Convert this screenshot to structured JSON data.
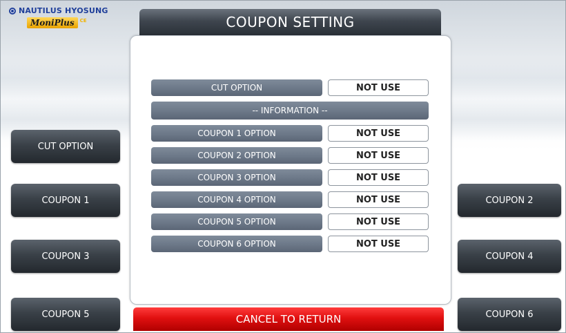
{
  "brand": {
    "company": "NAUTILUS HYOSUNG",
    "product": "MoniPlus",
    "product_suffix": "CE"
  },
  "title": "COUPON SETTING",
  "settings": {
    "cut_option": {
      "label": "CUT OPTION",
      "value": "NOT USE"
    },
    "information_header": "-- INFORMATION --",
    "coupons": [
      {
        "label": "COUPON 1 OPTION",
        "value": "NOT USE"
      },
      {
        "label": "COUPON 2 OPTION",
        "value": "NOT USE"
      },
      {
        "label": "COUPON 3 OPTION",
        "value": "NOT USE"
      },
      {
        "label": "COUPON 4 OPTION",
        "value": "NOT USE"
      },
      {
        "label": "COUPON 5 OPTION",
        "value": "NOT USE"
      },
      {
        "label": "COUPON 6 OPTION",
        "value": "NOT USE"
      }
    ]
  },
  "left_buttons": [
    "CUT OPTION",
    "COUPON 1",
    "COUPON 3",
    "COUPON 5"
  ],
  "right_buttons": [
    "COUPON 2",
    "COUPON 4",
    "COUPON 6"
  ],
  "cancel_label": "CANCEL TO RETURN",
  "colors": {
    "title_bar": "#3f464f",
    "row_label": "#6c7888",
    "side_button": "#3a4148",
    "cancel": "#e01010"
  }
}
